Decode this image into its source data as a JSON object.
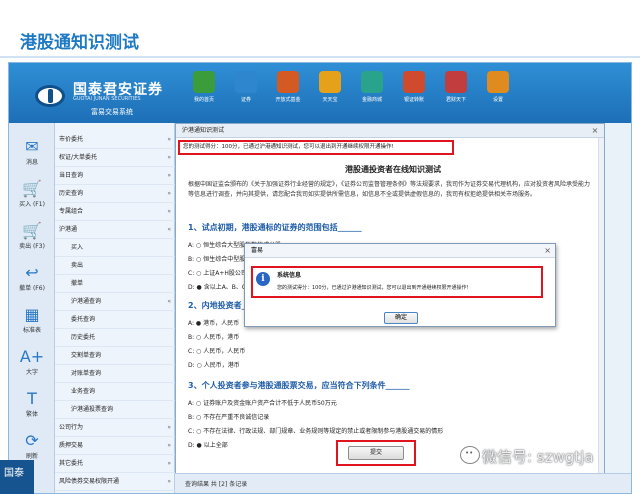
{
  "slide": {
    "title": "港股通知识测试"
  },
  "brand": {
    "name_cn": "国泰君安证券",
    "name_en": "GUOTAI JUNAN SECURITIES",
    "system": "富易交易系统"
  },
  "toolbar": [
    {
      "label": "我的首页",
      "color": "#3a9c3a",
      "icon": "home-icon"
    },
    {
      "label": "证券",
      "color": "#2e86cf",
      "icon": "chart-icon"
    },
    {
      "label": "开放式基金",
      "color": "#d45a24",
      "icon": "fund-icon"
    },
    {
      "label": "天天宝",
      "color": "#e6a11a",
      "icon": "bag-icon"
    },
    {
      "label": "金融商城",
      "color": "#2aa38d",
      "icon": "mall-icon"
    },
    {
      "label": "银证转账",
      "color": "#d04b2e",
      "icon": "transfer-icon"
    },
    {
      "label": "君财天下",
      "color": "#c23d3d",
      "icon": "book-icon"
    },
    {
      "label": "设置",
      "color": "#e08b1f",
      "icon": "gear-icon"
    }
  ],
  "left_icons": [
    {
      "label": "消息",
      "glyph": "✉",
      "icon": "message-icon"
    },
    {
      "label": "买入 (F1)",
      "glyph": "🛒",
      "icon": "buy-icon"
    },
    {
      "label": "卖出 (F3)",
      "glyph": "🛒",
      "icon": "sell-icon"
    },
    {
      "label": "撤单 (F6)",
      "glyph": "↩",
      "icon": "cancel-order-icon"
    },
    {
      "label": "标准表",
      "glyph": "▦",
      "icon": "grid-icon"
    },
    {
      "label": "大字",
      "glyph": "A+",
      "icon": "font-size-icon"
    },
    {
      "label": "繁体",
      "glyph": "T",
      "icon": "traditional-icon"
    },
    {
      "label": "刷新",
      "glyph": "⟳",
      "icon": "refresh-icon"
    }
  ],
  "nav": [
    {
      "label": "市价委托",
      "sub": false,
      "arrow": "»"
    },
    {
      "label": "权证/大单委托",
      "sub": false,
      "arrow": "»"
    },
    {
      "label": "当日查询",
      "sub": false,
      "arrow": "»"
    },
    {
      "label": "历史查询",
      "sub": false,
      "arrow": "»"
    },
    {
      "label": "专属组合",
      "sub": false,
      "arrow": "»"
    },
    {
      "label": "沪港通",
      "sub": false,
      "arrow": "«"
    },
    {
      "label": "买入",
      "sub": true,
      "arrow": ""
    },
    {
      "label": "卖出",
      "sub": true,
      "arrow": ""
    },
    {
      "label": "撤单",
      "sub": true,
      "arrow": ""
    },
    {
      "label": "沪港通查询",
      "sub": true,
      "arrow": "«"
    },
    {
      "label": "委托查询",
      "sub": true,
      "arrow": ""
    },
    {
      "label": "历史委托",
      "sub": true,
      "arrow": ""
    },
    {
      "label": "交割单查询",
      "sub": true,
      "arrow": ""
    },
    {
      "label": "对账单查询",
      "sub": true,
      "arrow": ""
    },
    {
      "label": "业务查询",
      "sub": true,
      "arrow": ""
    },
    {
      "label": "沪港通投票查询",
      "sub": true,
      "arrow": ""
    },
    {
      "label": "公司行为",
      "sub": false,
      "arrow": "»"
    },
    {
      "label": "质押交易",
      "sub": false,
      "arrow": "»"
    },
    {
      "label": "其它委托",
      "sub": false,
      "arrow": "»"
    },
    {
      "label": "风险债券交易权限开通",
      "sub": false,
      "arrow": "»"
    }
  ],
  "dialog": {
    "title": "沪港通知识测试",
    "close": "×",
    "result_text": "您的测试得分：100分，已通过沪港通知识测试，您可以退出到开通继续权限开通操作!",
    "q_title": "港股通投资者在线知识测试",
    "intro": "根据中国证监会颁布的《关于加强证券行业经营的规定》，《证券公司监督管理条例》等法规要求，我司作为证券交易代理机构，应对投资者风险承受能力等信息进行调查，并向其提供，请您配合我司如实提供所需信息，如信息不全或提供虚假信息的，我司有权拒绝提供相关市场服务。",
    "q1": "1、试点初期，港股通标的证券的范围包括______",
    "q1_options": [
      {
        "text": "A: ○ 恒生综合大型股指数的成分股",
        "on": false
      },
      {
        "text": "B: ○ 恒生综合中型股指数的成分股",
        "on": false
      },
      {
        "text": "C: ○ 上证A+H股公司的H股",
        "on": false
      },
      {
        "text": "D: ● 含以上A、B、C，还包括同时在联交所和上海证券交易所上市的A+H股公司的H股",
        "on": true
      }
    ],
    "q2": "2、内地投资者______",
    "q2_options": [
      {
        "text": "A: ● 港币，人民币",
        "on": true
      },
      {
        "text": "B: ○ 人民币，港币",
        "on": false
      },
      {
        "text": "C: ○ 人民币，人民币",
        "on": false
      },
      {
        "text": "D: ○ 人民币，港币",
        "on": false
      }
    ],
    "q3": "3、个人投资者参与港股通股票交易，应当符合下列条件______",
    "q3_options": [
      {
        "text": "A: ○ 证券账户及资金账户资产合计不低于人民币50万元",
        "on": false
      },
      {
        "text": "B: ○ 不存在严重不良诚信记录",
        "on": false
      },
      {
        "text": "C: ○ 不存在法律、行政法规、部门规章、业务规则等规定的禁止或者限制参与港股通交易的情形",
        "on": false
      },
      {
        "text": "D: ● 以上全部",
        "on": true
      }
    ],
    "submit": "提交"
  },
  "alert": {
    "title": "富易",
    "close": "×",
    "heading": "系统信息",
    "message": "您的测试得分：100分，已通过沪港通知识测试，您可以退出到开通继续权限开通操作!",
    "ok": "确定"
  },
  "status_bar": {
    "text": "查询结果 共 [2] 条记录"
  },
  "watermark": {
    "text": "微信号: szwgtja"
  },
  "corner": {
    "text": "国泰"
  }
}
